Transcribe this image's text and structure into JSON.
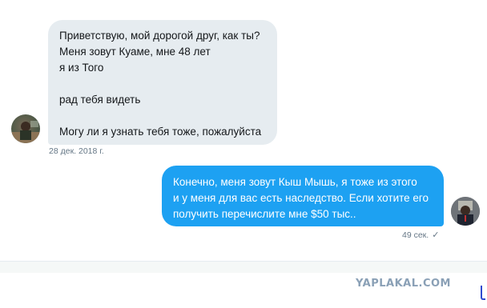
{
  "incoming": {
    "lines": [
      "Приветствую, мой дорогой друг, как ты?",
      "Меня зовут Куаме, мне 48 лет",
      "я из Того",
      "",
      "рад тебя видеть",
      "",
      "Могу ли я узнать тебя тоже, пожалуйста"
    ],
    "timestamp": "28 дек. 2018 г."
  },
  "outgoing": {
    "lines": [
      "Конечно, меня зовут Кыш Мышь, я тоже из этого",
      "и у меня для вас есть наследство. Если хотите его",
      "получить перечислите мне $50 тыс.."
    ],
    "timestamp": "49 сек.",
    "status_icon": "checkmark-icon"
  },
  "watermark": "YAPLAKAL.COM",
  "colors": {
    "incoming_bubble": "#e6ecf0",
    "outgoing_bubble": "#1da1f2",
    "meta_text": "#657786"
  }
}
